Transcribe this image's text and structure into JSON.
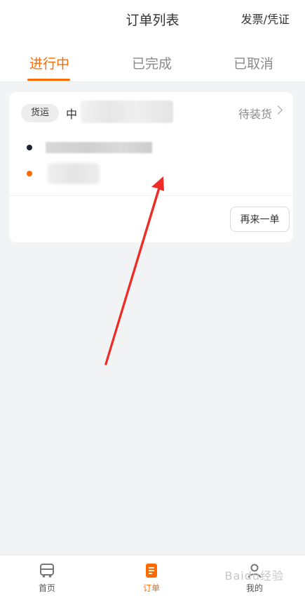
{
  "header": {
    "title": "订单列表",
    "invoice_link": "发票/凭证"
  },
  "tabs": [
    {
      "label": "进行中",
      "active": true
    },
    {
      "label": "已完成",
      "active": false
    },
    {
      "label": "已取消",
      "active": false
    }
  ],
  "order": {
    "tag": "货运",
    "name_prefix": "中",
    "status": "待装货",
    "reorder_label": "再来一单"
  },
  "bottom_nav": [
    {
      "label": "首页",
      "icon": "truck-icon",
      "active": false
    },
    {
      "label": "订单",
      "icon": "order-doc-icon",
      "active": true
    },
    {
      "label": "我的",
      "icon": "profile-icon",
      "active": false
    }
  ],
  "watermark": "Baidu经验",
  "colors": {
    "accent": "#ff6a00",
    "annotation_arrow": "#ee2b24"
  }
}
